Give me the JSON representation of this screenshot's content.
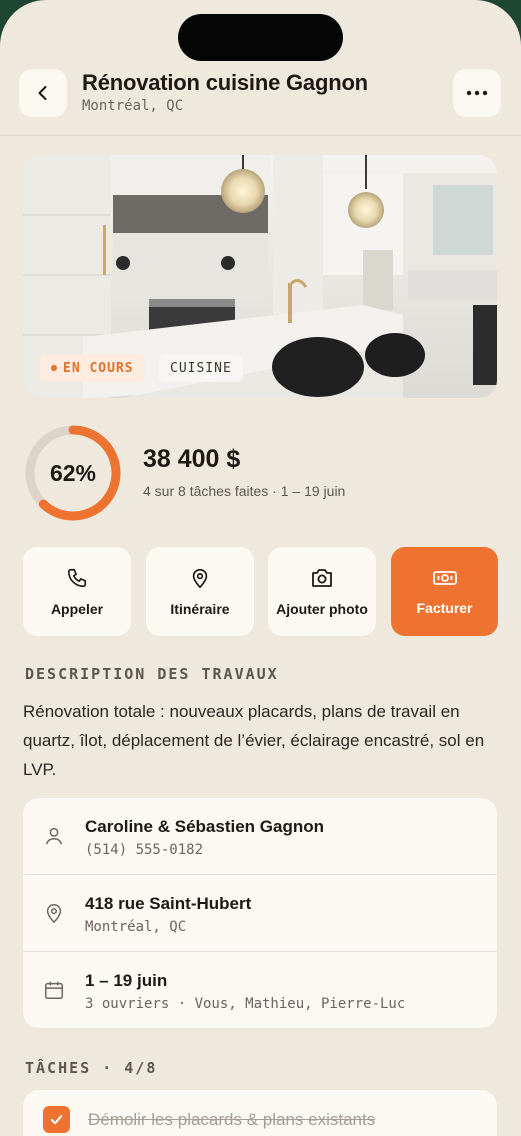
{
  "header": {
    "title": "Rénovation cuisine Gagnon",
    "subtitle": "Montréal, QC"
  },
  "hero": {
    "status_label": "EN COURS",
    "category_label": "CUISINE"
  },
  "summary": {
    "progress_percent": 62,
    "progress_label": "62%",
    "amount": "38 400 $",
    "progress_text": "4 sur 8 tâches faites · 1 – 19 juin"
  },
  "actions": [
    {
      "label": "Appeler",
      "icon": "phone-icon"
    },
    {
      "label": "Itinéraire",
      "icon": "map-pin-icon"
    },
    {
      "label": "Ajouter photo",
      "icon": "camera-icon"
    },
    {
      "label": "Facturer",
      "icon": "invoice-icon"
    }
  ],
  "description": {
    "heading": "DESCRIPTION DES TRAVAUX",
    "text": "Rénovation totale : nouveaux placards, plans de travail en quartz, îlot, déplacement de l’évier, éclairage encastré, sol en LVP."
  },
  "info": {
    "client_name": "Caroline & Sébastien Gagnon",
    "client_phone": "(514) 555-0182",
    "address": "418 rue Saint-Hubert",
    "city": "Montréal, QC",
    "dates": "1 – 19 juin",
    "crew": "3 ouvriers · Vous, Mathieu, Pierre-Luc"
  },
  "tasks": {
    "heading": "TÂCHES · 4/8",
    "items": [
      {
        "label": "Démolir les placards & plans existants",
        "done": true
      }
    ]
  },
  "colors": {
    "accent": "#ee7331",
    "background": "#efe8dd",
    "card": "#fcf9f3",
    "outer": "#1f4633"
  }
}
